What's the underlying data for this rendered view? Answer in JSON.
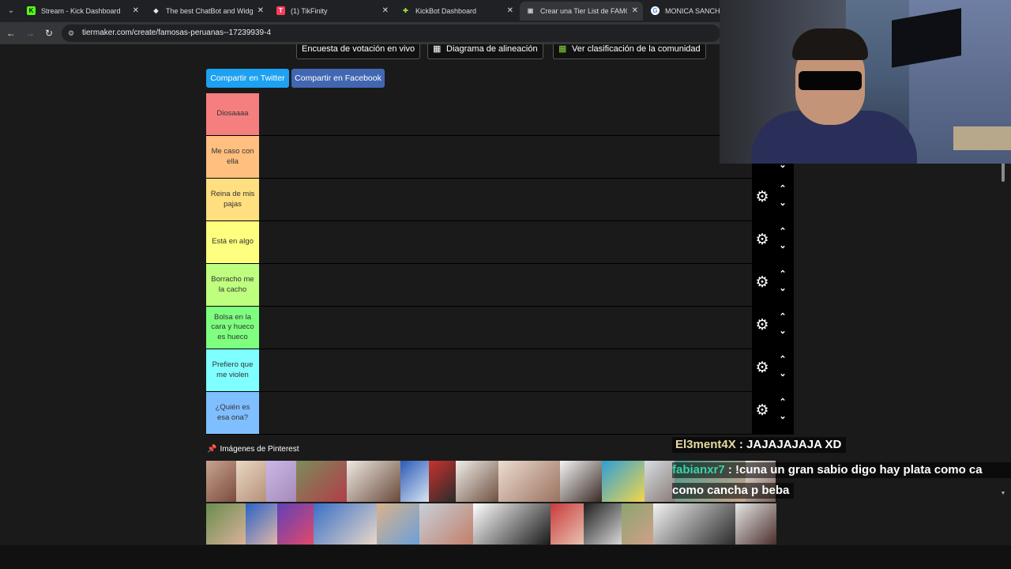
{
  "browser": {
    "tabs": [
      {
        "title": "Stream - Kick Dashboard",
        "favicon": "K",
        "favicon_color": "#53fc18",
        "active": false
      },
      {
        "title": "The best ChatBot and Widgets",
        "favicon": "◆",
        "favicon_color": "#e6e6e6",
        "active": false
      },
      {
        "title": "(1) TikFinity",
        "favicon": "T",
        "favicon_color": "#ff3b5c",
        "active": false
      },
      {
        "title": "KickBot Dashboard",
        "favicon": "✚",
        "favicon_color": "#9be03a",
        "active": false
      },
      {
        "title": "Crear una Tier List de FAMOSAS",
        "favicon": "▣",
        "favicon_color": "#c8c8c8",
        "active": true
      },
      {
        "title": "MONICA SANCHEZ -",
        "favicon": "G",
        "favicon_color": "#4285f4",
        "active": false
      }
    ],
    "url": "tiermaker.com/create/famosas-peruanas--17239939-4"
  },
  "page": {
    "top_buttons": [
      {
        "label": "Encuesta de votación en vivo",
        "icon": "poll-icon"
      },
      {
        "label": "Diagrama de alineación",
        "icon": "grid-icon"
      },
      {
        "label": "Ver clasificación de la comunidad",
        "icon": "colored-grid-icon"
      }
    ],
    "share_twitter": "Compartir en Twitter",
    "share_facebook": "Compartir en Facebook",
    "tiers": [
      {
        "label": "Diosaaaa",
        "color": "#f57f7f"
      },
      {
        "label": "Me caso con ella",
        "color": "#ffbf7f"
      },
      {
        "label": "Reina de mis pajas",
        "color": "#ffdf7f"
      },
      {
        "label": "Está en algo",
        "color": "#ffff7f"
      },
      {
        "label": "Borracho me la cacho",
        "color": "#bfff7f"
      },
      {
        "label": "Bolsa en la cara y hueco es hueco",
        "color": "#7fff7f"
      },
      {
        "label": "Prefiero que me violen",
        "color": "#7fffff"
      },
      {
        "label": "¿Quién es esa ona?",
        "color": "#7fbfff"
      }
    ],
    "pinterest_label": "Imágenes de Pinterest"
  },
  "overlay": {
    "chat": [
      {
        "user": "El3ment4X",
        "message": " : JAJAJAJAJA XD"
      },
      {
        "user": "fabianxr7",
        "message": " : !cuna un gran sabio digo hay plata como ca"
      },
      {
        "user": "",
        "message": "como cancha p beba"
      }
    ]
  }
}
